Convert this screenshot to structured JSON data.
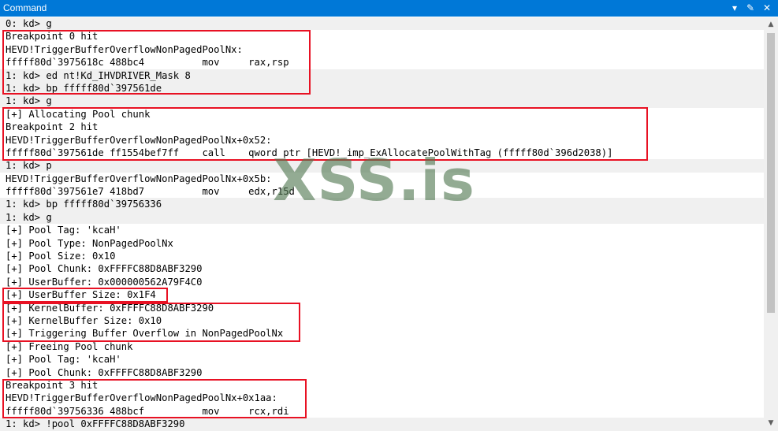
{
  "window": {
    "title": "Command",
    "buttons": {
      "dropdown": "▾",
      "pin": "✎",
      "close": "✕"
    }
  },
  "console_lines": [
    "0: kd> g",
    "Breakpoint 0 hit",
    "HEVD!TriggerBufferOverflowNonPagedPoolNx:",
    "fffff80d`3975618c 488bc4          mov     rax,rsp",
    "1: kd> ed nt!Kd_IHVDRIVER_Mask 8",
    "1: kd> bp fffff80d`397561de",
    "1: kd> g",
    "[+] Allocating Pool chunk",
    "Breakpoint 2 hit",
    "HEVD!TriggerBufferOverflowNonPagedPoolNx+0x52:",
    "fffff80d`397561de ff1554bef7ff    call    qword ptr [HEVD!_imp_ExAllocatePoolWithTag (fffff80d`396d2038)]",
    "1: kd> p",
    "HEVD!TriggerBufferOverflowNonPagedPoolNx+0x5b:",
    "fffff80d`397561e7 418bd7          mov     edx,r15d",
    "1: kd> bp fffff80d`39756336",
    "1: kd> g",
    "[+] Pool Tag: 'kcaH'",
    "[+] Pool Type: NonPagedPoolNx",
    "[+] Pool Size: 0x10",
    "[+] Pool Chunk: 0xFFFFC88D8ABF3290",
    "[+] UserBuffer: 0x000000562A79F4C0",
    "[+] UserBuffer Size: 0x1F4",
    "[+] KernelBuffer: 0xFFFFC88D8ABF3290",
    "[+] KernelBuffer Size: 0x10",
    "[+] Triggering Buffer Overflow in NonPagedPoolNx",
    "[+] Freeing Pool chunk",
    "[+] Pool Tag: 'kcaH'",
    "[+] Pool Chunk: 0xFFFFC88D8ABF3290",
    "Breakpoint 3 hit",
    "HEVD!TriggerBufferOverflowNonPagedPoolNx+0x1aa:",
    "fffff80d`39756336 488bcf          mov     rcx,rdi",
    "1: kd> !pool 0xFFFFC88D8ABF3290"
  ],
  "watermark": "XSS.is",
  "scrollbar": {
    "up": "▲",
    "down": "▼"
  }
}
